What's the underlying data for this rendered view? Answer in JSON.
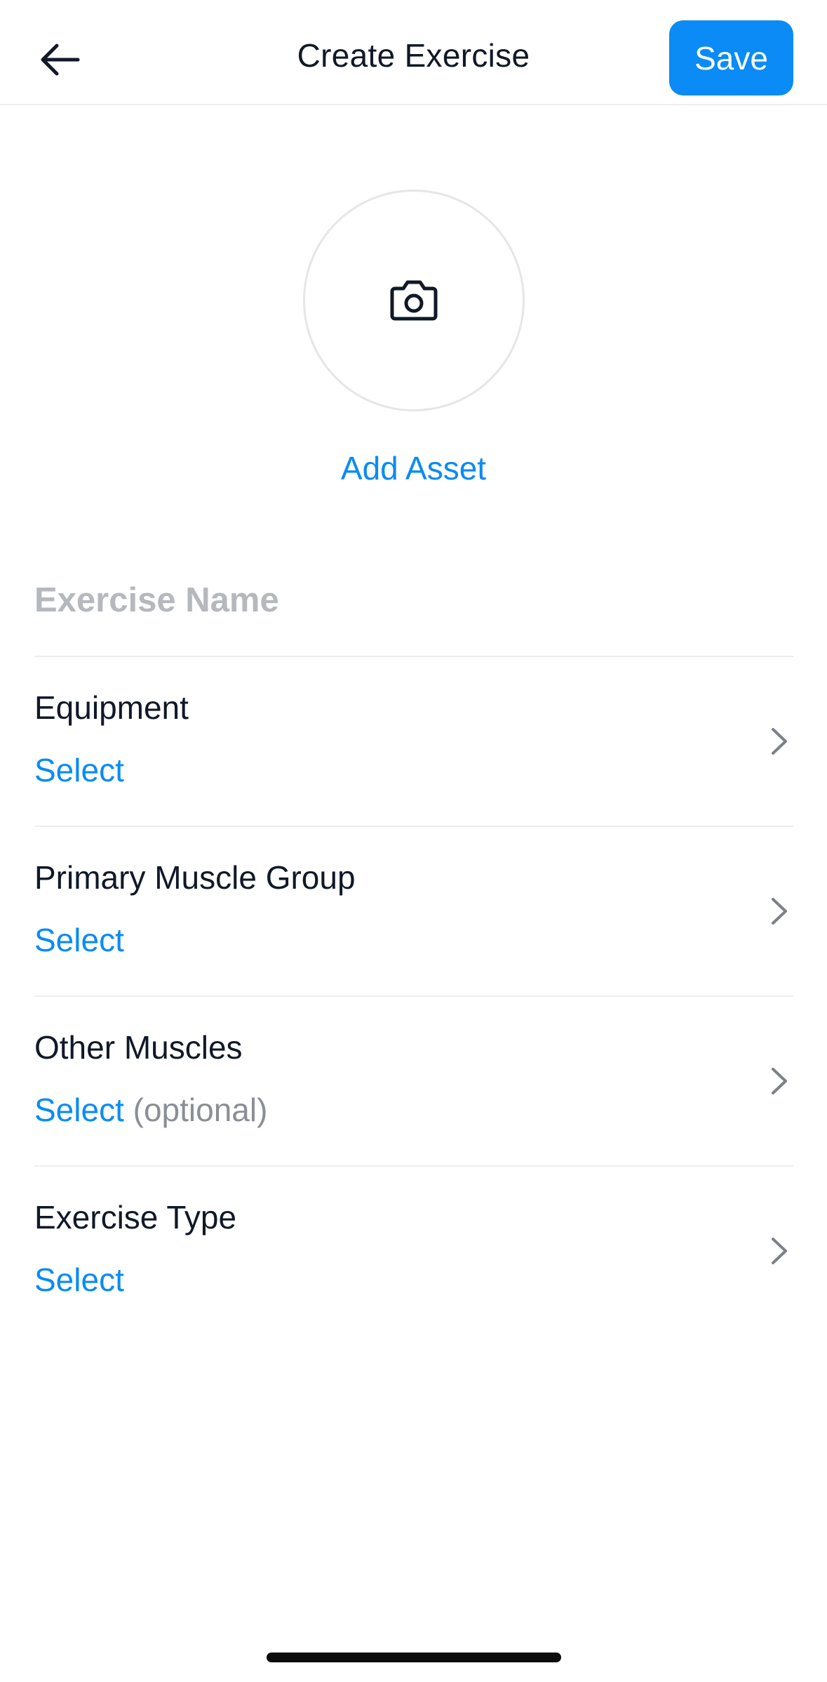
{
  "header": {
    "back_icon": "arrow-left-icon",
    "title": "Create Exercise",
    "save_label": "Save"
  },
  "asset": {
    "icon": "camera-icon",
    "label": "Add Asset"
  },
  "name_field": {
    "value": "",
    "placeholder": "Exercise Name"
  },
  "rows": [
    {
      "label": "Equipment",
      "value": "Select",
      "suffix": ""
    },
    {
      "label": "Primary Muscle Group",
      "value": "Select",
      "suffix": ""
    },
    {
      "label": "Other Muscles",
      "value": "Select",
      "suffix": "(optional)"
    },
    {
      "label": "Exercise Type",
      "value": "Select",
      "suffix": ""
    }
  ],
  "colors": {
    "accent": "#0a8bf5",
    "text": "#111827",
    "muted": "#8a8f96",
    "placeholder": "#b5b8bc",
    "divider": "#eeeeee"
  }
}
